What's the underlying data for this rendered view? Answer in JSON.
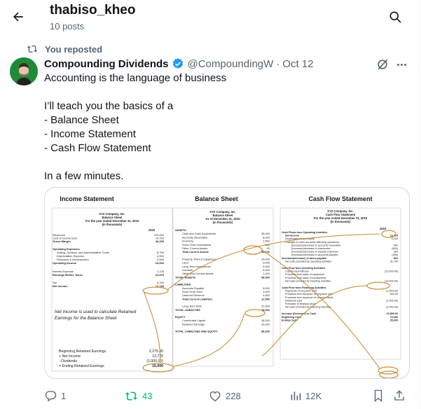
{
  "header": {
    "profile_name": "thabiso_kheo",
    "post_count": "10 posts"
  },
  "repost_label": "You reposted",
  "tweet": {
    "author": "Compounding Dividends",
    "handle": "@CompoundingW",
    "separator": "·",
    "date": "Oct 12",
    "text_lines": [
      "Accounting is the language of business",
      "",
      "I’ll teach you the basics of a",
      "- Balance Sheet",
      "- Income Statement",
      "- Cash Flow Statement",
      "",
      "In a few minutes."
    ]
  },
  "media": {
    "panel_titles": [
      "Income Statement",
      "Balance Sheet",
      "Cash Flow Statement"
    ],
    "income": {
      "company": "XYZ Company, Inc.",
      "subtitle": "Balance Sheet",
      "period": "For the year ended December 31, 2010",
      "units": "(in thousands)",
      "year": "2010",
      "rows": [
        {
          "label": "Revenues",
          "value": "115,000"
        },
        {
          "label": "Cost of Goods Sold",
          "value": "74,750"
        },
        {
          "label": "Gross Margin",
          "value": "40,250"
        },
        {
          "label": "Operating Expenses",
          "value": ""
        },
        {
          "label": "Selling, General, and Administrative Costs",
          "value": "8,750"
        },
        {
          "label": "Depreciation Expense",
          "value": "4,000"
        },
        {
          "label": "Research & Development",
          "value": "2,500"
        },
        {
          "label": "Operating Income",
          "value": "24,000"
        },
        {
          "label": "Interest Expense",
          "value": "1,125"
        },
        {
          "label": "Earnings Before Taxes",
          "value": "22,875"
        },
        {
          "label": "Tax",
          "value": "9,150"
        },
        {
          "label": "Net Income",
          "value": "13,725"
        }
      ],
      "note": "Net Income is used to calculate Retained Earnings for the Balance Sheet",
      "retained": [
        {
          "label": "Beginning Retained Earnings",
          "value": "3,275.00"
        },
        {
          "label": "+ Net Income",
          "value": "13,725"
        },
        {
          "label": "- Dividends",
          "value": "(2,000.00)"
        },
        {
          "label": "= Ending Retained Earnings",
          "value": "15,000"
        }
      ]
    },
    "balance": {
      "company": "XYZ Company, Inc.",
      "subtitle": "Balance Sheet",
      "period": "As of December 31, 2010",
      "units": "(in thousands)",
      "rows": [
        {
          "label": "ASSETS",
          "value": ""
        },
        {
          "label": "Cash and Cash Equivalents",
          "value": "35,000"
        },
        {
          "label": "Accounts Receivable",
          "value": "6,000"
        },
        {
          "label": "Inventory",
          "value": "1,500"
        },
        {
          "label": "Short-Term Investments",
          "value": "580"
        },
        {
          "label": "Other Current Assets",
          "value": "20"
        },
        {
          "label": "Total Current Assets",
          "value": "43,100"
        },
        {
          "label": "Property, Plant & Equipment",
          "value": "25,000"
        },
        {
          "label": "Land",
          "value": "9,000"
        },
        {
          "label": "Long-Term Investments",
          "value": "5,000"
        },
        {
          "label": "Goodwill",
          "value": "5,000"
        },
        {
          "label": "Other Non-Current Assets",
          "value": "1,200"
        },
        {
          "label": "TOTAL ASSETS",
          "value": "88,300"
        },
        {
          "label": "LIABILITIES",
          "value": ""
        },
        {
          "label": "Accounts Payable",
          "value": "5,000"
        },
        {
          "label": "Short-Term Debt",
          "value": "3,000"
        },
        {
          "label": "Deferred Revenue",
          "value": "4,500"
        },
        {
          "label": "Total Current Liabilities",
          "value": "12,500"
        },
        {
          "label": "Long-Term Debt",
          "value": "22,500"
        },
        {
          "label": "TOTAL LIABILITIES",
          "value": "35,000"
        },
        {
          "label": "EQUITY",
          "value": ""
        },
        {
          "label": "Contributed Capital",
          "value": "38,300"
        },
        {
          "label": "Retained Earnings",
          "value": "15,000"
        },
        {
          "label": "TOTAL LIABILITIES AND EQUITY",
          "value": "88,300"
        }
      ]
    },
    "cashflow": {
      "company": "XYZ Company, Inc.",
      "subtitle": "Cash Flow Statement",
      "period": "For the year ended December 31, 2010",
      "units": "(in thousands)",
      "year": "2010",
      "rows": [
        {
          "label": "Cash Flows from Operating Activities",
          "value": ""
        },
        {
          "label": "Net Income",
          "value": "13,725"
        },
        {
          "label": "Depreciation/Amortization",
          "value": "4,000"
        },
        {
          "label": "Changes in other accounts affecting operations:",
          "value": ""
        },
        {
          "label": "(Increase)/decrease in accounts receivable",
          "value": "500"
        },
        {
          "label": "(Increase)/decrease in inventories",
          "value": "(600)"
        },
        {
          "label": "(Increase)/decrease in prepaid expenses",
          "value": "300"
        },
        {
          "label": "(Increase)/decrease in accounts payable",
          "value": "(450)"
        },
        {
          "label": "Increase/(decrease) in taxes payable",
          "value": "500"
        },
        {
          "label": "Net cash provided by operating activities",
          "value": "31,700"
        },
        {
          "label": "Cash Flow from Investing Activities",
          "value": ""
        },
        {
          "label": "Capital expenditures",
          "value": "(13,000.00)"
        },
        {
          "label": "Proceeds from sales of equipment",
          "value": ""
        },
        {
          "label": "Proceeds from sales of investments",
          "value": ""
        },
        {
          "label": "Net cash provided by investing activities",
          "value": "(13,000.00)"
        },
        {
          "label": "Cash Flow from Financing Activities",
          "value": ""
        },
        {
          "label": "Payments of long-term debt",
          "value": "(1,250.00)"
        },
        {
          "label": "Proceeds from issuance of long-term debt",
          "value": "500.00"
        },
        {
          "label": "Proceeds from issuance of common stock",
          "value": ""
        },
        {
          "label": "Dividends paid",
          "value": "(2,000.00)"
        },
        {
          "label": "Purchase of treasury stock",
          "value": ""
        },
        {
          "label": "Net cash provided by financing activities",
          "value": "(2,750.00)"
        },
        {
          "label": "Increase (Decrease) in Cash",
          "value": "15,950.00"
        },
        {
          "label": "Beginning Cash",
          "value": "19,050"
        },
        {
          "label": "Ending Cash",
          "value": "35,000"
        }
      ]
    }
  },
  "actions": {
    "replies": "1",
    "reposts": "43",
    "likes": "228",
    "views": "12K"
  },
  "colors": {
    "accent": "#1d9bf0",
    "repost_green": "#00ba7c",
    "muted": "#536471",
    "annotation": "#c8913a"
  },
  "icons": [
    "back-arrow-icon",
    "search-icon",
    "repost-icon",
    "verified-icon",
    "grok-icon",
    "more-icon",
    "reply-icon",
    "like-icon",
    "views-icon",
    "bookmark-icon",
    "share-icon"
  ]
}
